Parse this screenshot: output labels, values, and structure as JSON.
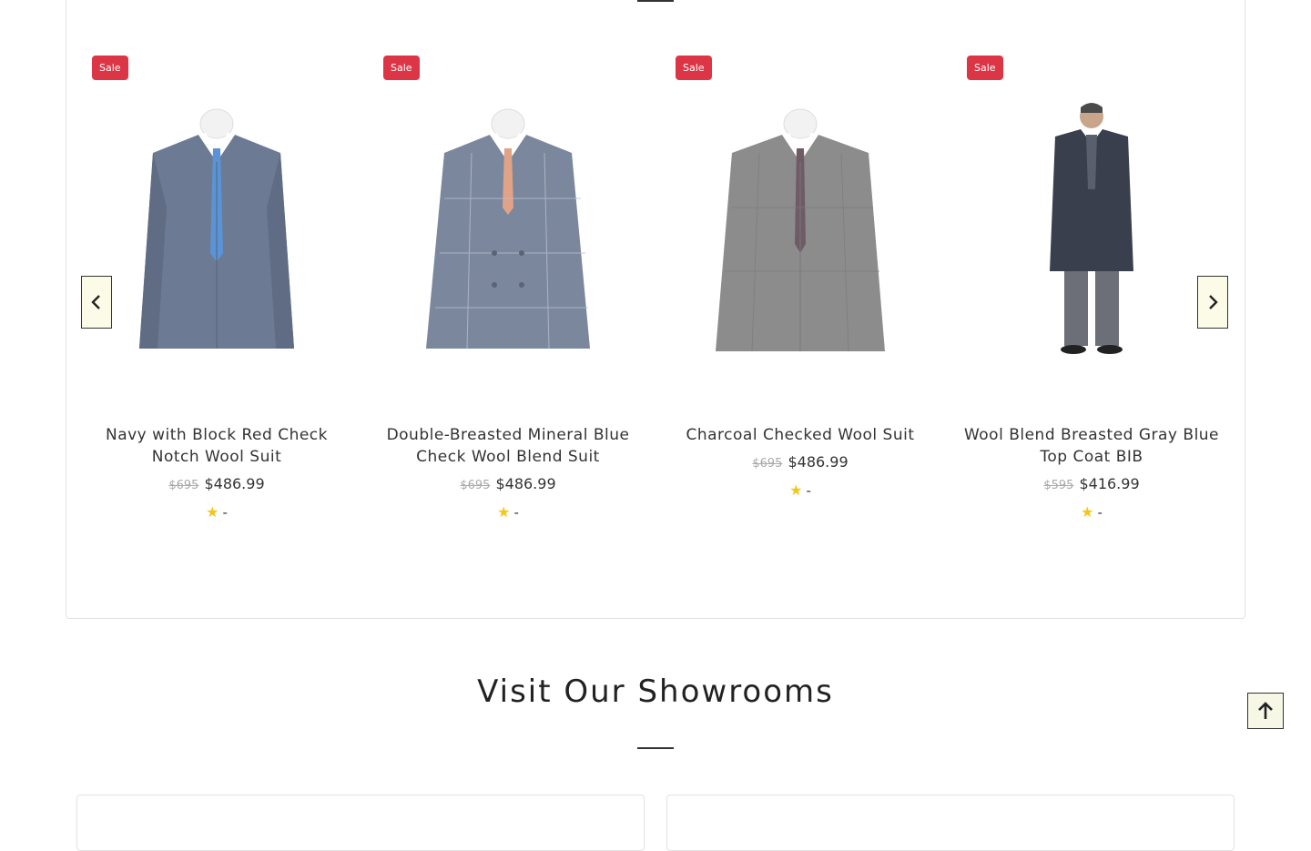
{
  "products": [
    {
      "badge": "Sale",
      "title": "Navy with Block Red Check Notch Wool Suit",
      "old_price": "$695",
      "price": "$486.99",
      "rating": "-"
    },
    {
      "badge": "Sale",
      "title": "Double-Breasted Mineral Blue Check Wool Blend Suit",
      "old_price": "$695",
      "price": "$486.99",
      "rating": "-"
    },
    {
      "badge": "Sale",
      "title": "Charcoal Checked Wool Suit",
      "old_price": "$695",
      "price": "$486.99",
      "rating": "-"
    },
    {
      "badge": "Sale",
      "title": "Wool Blend Breasted Gray Blue Top Coat BIB",
      "old_price": "$595",
      "price": "$416.99",
      "rating": "-"
    }
  ],
  "carousel": {
    "prev_icon": "chevron-left-icon",
    "next_icon": "chevron-right-icon"
  },
  "showrooms": {
    "title": "Visit Our Showrooms"
  },
  "back_to_top": {
    "icon": "arrow-up-icon"
  },
  "colors": {
    "sale_badge": "#dc3545",
    "star": "#f5c518",
    "accent_divider": "#333333"
  }
}
